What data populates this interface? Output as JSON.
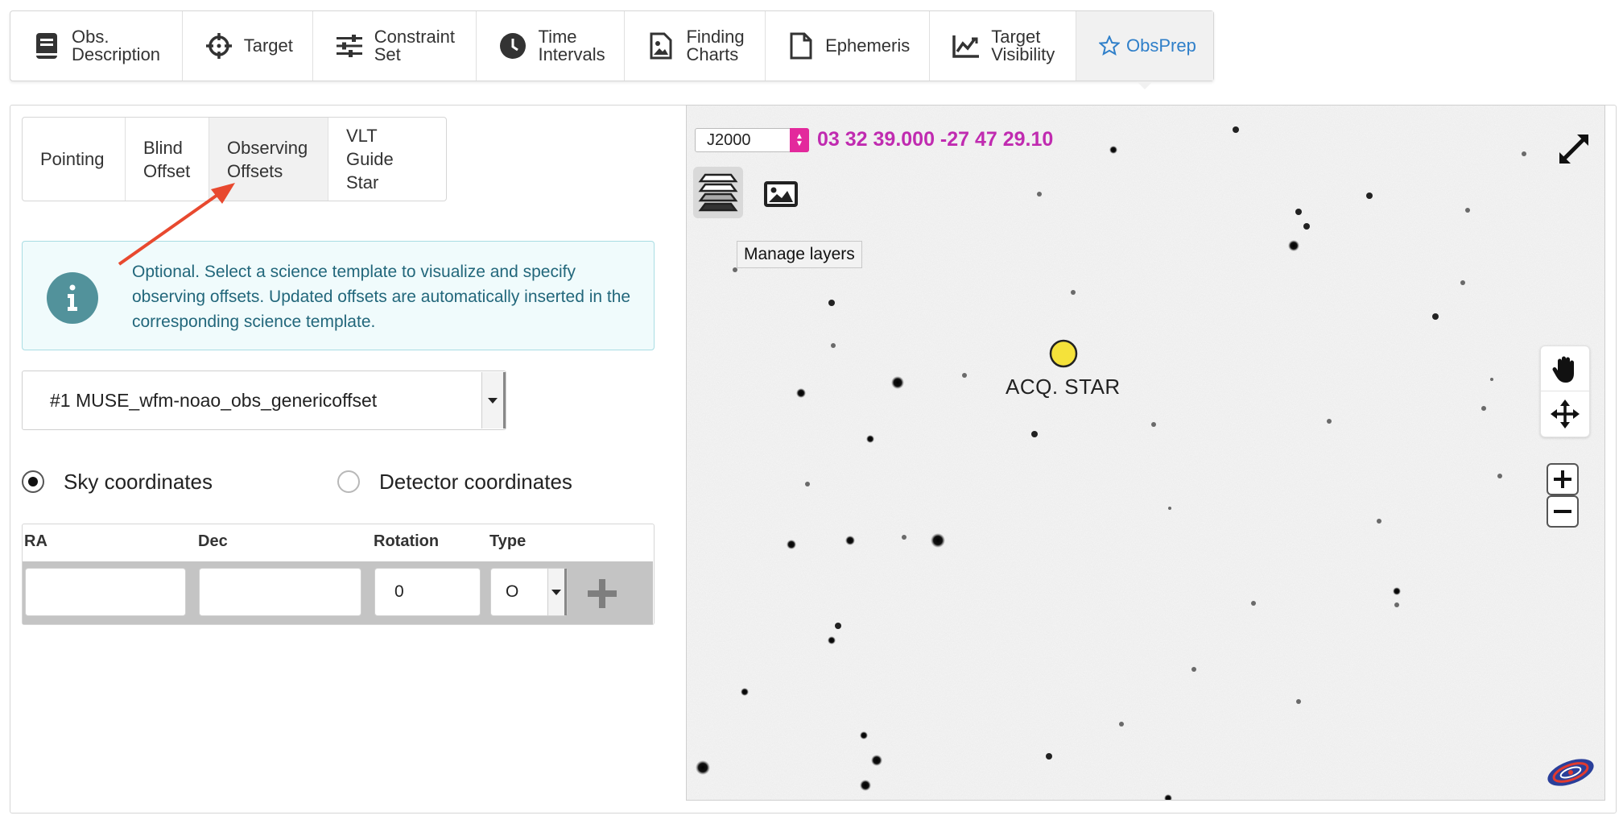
{
  "top_tabs": [
    {
      "label": "Obs.\nDescription",
      "icon": "book-icon",
      "active": false
    },
    {
      "label": "Target",
      "icon": "crosshair-icon",
      "active": false
    },
    {
      "label": "Constraint\nSet",
      "icon": "sliders-icon",
      "active": false
    },
    {
      "label": "Time\nIntervals",
      "icon": "clock-icon",
      "active": false
    },
    {
      "label": "Finding\nCharts",
      "icon": "image-file-icon",
      "active": false
    },
    {
      "label": "Ephemeris",
      "icon": "file-icon",
      "active": false
    },
    {
      "label": "Target\nVisibility",
      "icon": "line-chart-icon",
      "active": false
    },
    {
      "label": "ObsPrep",
      "icon": "star-icon",
      "active": true
    }
  ],
  "sub_tabs": [
    {
      "label": "Pointing",
      "active": false
    },
    {
      "label": "Blind\nOffset",
      "active": false
    },
    {
      "label": "Observing\nOffsets",
      "active": true
    },
    {
      "label": "VLT Guide\nStar",
      "active": false
    }
  ],
  "info": {
    "text": "Optional. Select a science template to visualize and specify observing offsets. Updated offsets are automatically inserted in the corresponding science template.",
    "icon": "info-icon"
  },
  "template_select": {
    "value": "#1 MUSE_wfm-noao_obs_genericoffset"
  },
  "coordinates": {
    "sky_label": "Sky coordinates",
    "detector_label": "Detector coordinates",
    "selected": "sky"
  },
  "offsets_table": {
    "headers": {
      "ra": "RA",
      "dec": "Dec",
      "rotation": "Rotation",
      "type": "Type"
    },
    "row": {
      "ra": "",
      "dec": "",
      "rotation": "0",
      "type": "O"
    },
    "add_icon": "plus-icon"
  },
  "sky_view": {
    "frame": "J2000",
    "coords": "03 32 39.000 -27 47 29.10",
    "tooltip": "Manage layers",
    "target_label": "ACQ. STAR",
    "target_color": "#f5e23a",
    "coords_color": "#c02bb0"
  },
  "colors": {
    "active_tab_text": "#2f7fc9",
    "info_text": "#22677b",
    "info_bg": "#f0fbfc",
    "annotation_arrow": "#e8492f"
  }
}
